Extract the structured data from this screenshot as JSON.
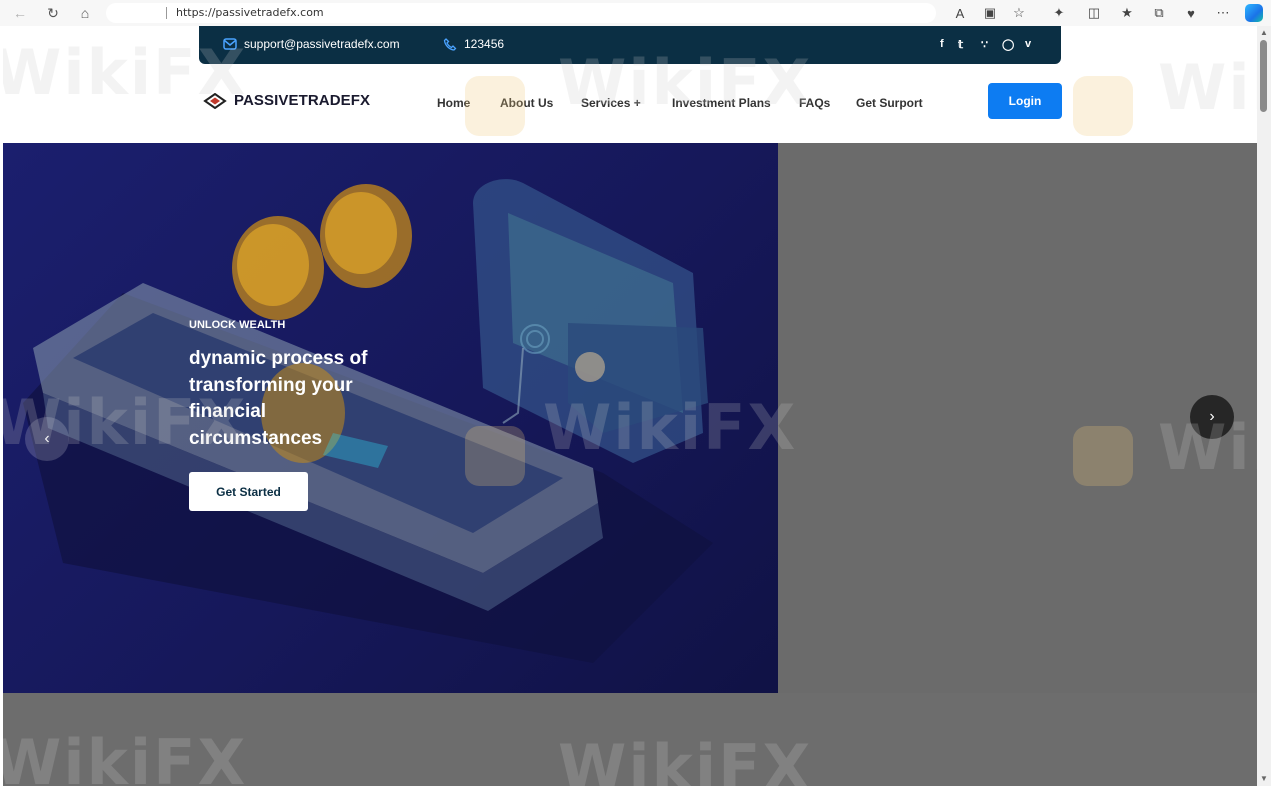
{
  "browser": {
    "url": "https://passivetradefx.com"
  },
  "topbar": {
    "email": "support@passivetradefx.com",
    "phone": "123456",
    "social_icons": [
      "facebook-icon",
      "twitter-icon",
      "rss-icon",
      "instagram-icon",
      "vimeo-icon"
    ]
  },
  "header": {
    "brand": "PASSIVETRADEFX",
    "menu": [
      "Home",
      "About Us",
      "Services +",
      "Investment Plans",
      "FAQs",
      "Get Surport"
    ],
    "login_label": "Login"
  },
  "hero": {
    "eyebrow": "UNLOCK WEALTH",
    "title": "dynamic process of transforming your financial circumstances",
    "cta_label": "Get Started"
  },
  "watermark": "WikiFX",
  "colors": {
    "topbar": "#0b2f44",
    "login": "#0d7cf2",
    "slide": "#1b1f6e",
    "overlay": "#6b6b6b"
  }
}
